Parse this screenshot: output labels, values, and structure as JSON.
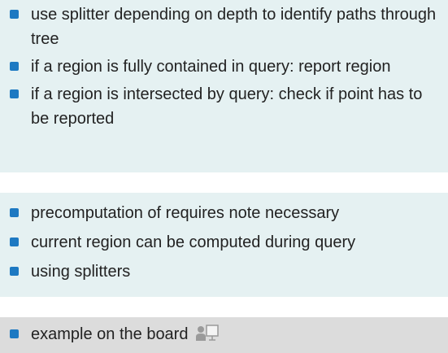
{
  "blocks": [
    {
      "items": [
        {
          "text": "use splitter depending on depth to identify paths through tree"
        },
        {
          "text": "if a region is fully contained in query: report region"
        },
        {
          "text": "if a region is intersected by query: check if point has to be reported"
        }
      ]
    },
    {
      "items": [
        {
          "text": "precomputation of requires note necessary"
        },
        {
          "text": "current region can be computed during query"
        },
        {
          "text": "using splitters"
        }
      ]
    },
    {
      "items": [
        {
          "text": "example on the board",
          "icon": "presenter-board-icon"
        }
      ]
    }
  ],
  "colors": {
    "bullet": "#1d79c2",
    "block_bg": "#e5f1f2",
    "example_bg": "#dcdcdc",
    "text": "#222222"
  }
}
